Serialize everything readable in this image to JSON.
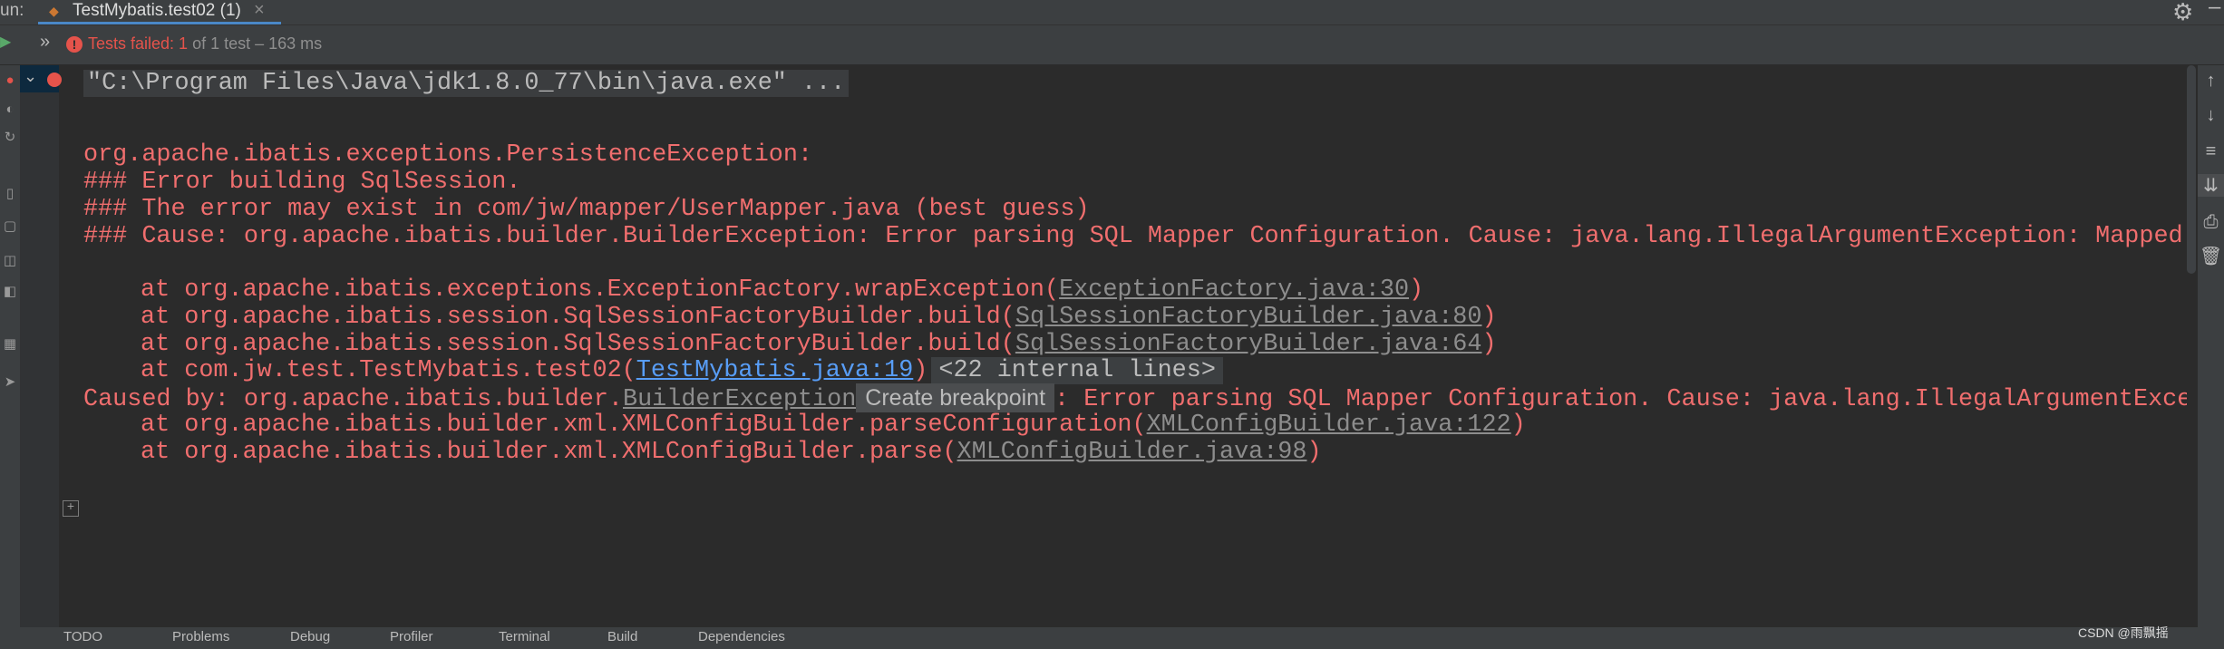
{
  "tabbar": {
    "run_label": "un:",
    "tab_title": "TestMybatis.test02 (1)",
    "tab_close": "×"
  },
  "status": {
    "fail_text": "Tests failed: 1",
    "info_text": "of 1 test – 163 ms"
  },
  "console": {
    "cmd": "\"C:\\Program Files\\Java\\jdk1.8.0_77\\bin\\java.exe\" ...",
    "lines": [
      "org.apache.ibatis.exceptions.PersistenceException:",
      "### Error building SqlSession.",
      "### The error may exist in com/jw/mapper/UserMapper.java (best guess)",
      "### Cause: org.apache.ibatis.builder.BuilderException: Error parsing SQL Mapper Configuration. Cause: java.lang.IllegalArgumentException: Mapped S"
    ],
    "stack": [
      {
        "prefix": "at org.apache.ibatis.exceptions.ExceptionFactory.wrapException(",
        "link": "ExceptionFactory.java:30",
        "suffix": ")"
      },
      {
        "prefix": "at org.apache.ibatis.session.SqlSessionFactoryBuilder.build(",
        "link": "SqlSessionFactoryBuilder.java:80",
        "suffix": ")"
      },
      {
        "prefix": "at org.apache.ibatis.session.SqlSessionFactoryBuilder.build(",
        "link": "SqlSessionFactoryBuilder.java:64",
        "suffix": ")"
      },
      {
        "prefix": "at com.jw.test.TestMybatis.test02(",
        "link": "TestMybatis.java:19",
        "suffix": ")"
      }
    ],
    "internal_lines": "<22 internal lines>",
    "caused_prefix": "Caused by: org.apache.ibatis.builder.",
    "caused_link": "BuilderException",
    "tooltip": "Create breakpoint",
    "caused_suffix": ": Error parsing SQL Mapper Configuration. Cause: java.lang.IllegalArgumentExce",
    "stack2": [
      {
        "prefix": "at org.apache.ibatis.builder.xml.XMLConfigBuilder.parseConfiguration(",
        "link": "XMLConfigBuilder.java:122",
        "suffix": ")"
      },
      {
        "prefix": "at org.apache.ibatis.builder.xml.XMLConfigBuilder.parse(",
        "link": "XMLConfigBuilder.java:98",
        "suffix": ")"
      }
    ]
  },
  "bottombar": {
    "items": [
      "TODO",
      "Problems",
      "Debug",
      "Profiler",
      "Terminal",
      "Build",
      "Dependencies"
    ]
  },
  "watermark": "CSDN @雨飘摇",
  "colors": {
    "error": "#f06e6e",
    "accent": "#4a88c7",
    "link_blue": "#589df6"
  }
}
